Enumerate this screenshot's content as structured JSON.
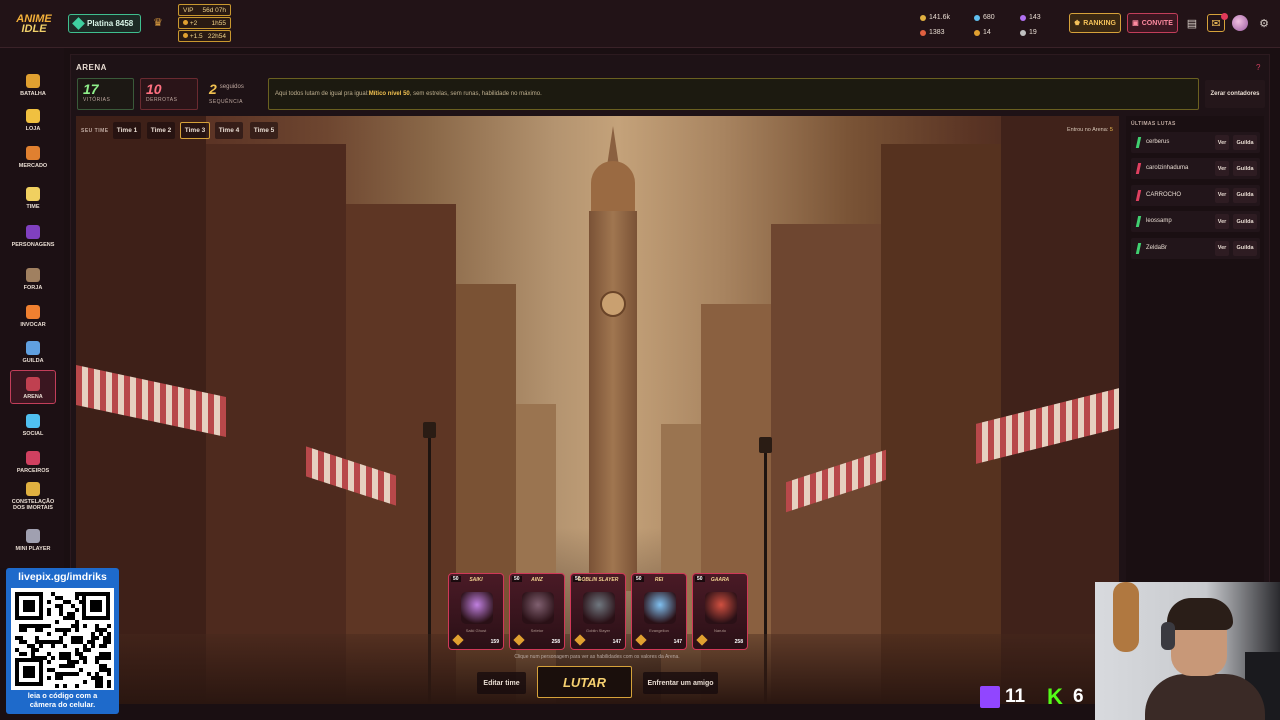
{
  "app": {
    "logo_line1": "ANIME",
    "logo_line2": "IDLE"
  },
  "topbar": {
    "rank": "Platina 8458",
    "vip": {
      "label": "VIP",
      "time": "56d 07h",
      "boost1_label": "+2",
      "boost1_time": "1h55",
      "boost2_label": "+1.5",
      "boost2_time": "22h54"
    },
    "currencies": [
      {
        "value": "141.6k",
        "color": "#e0b040"
      },
      {
        "value": "680",
        "color": "#60c0f0"
      },
      {
        "value": "143",
        "color": "#b070f0"
      },
      {
        "value": "1383",
        "color": "#e06040"
      },
      {
        "value": "14",
        "color": "#e0a030"
      },
      {
        "value": "19",
        "color": "#c0c0c0"
      }
    ],
    "ranking_label": "RANKING",
    "convite_label": "CONVITE"
  },
  "sidebar": [
    {
      "label": "BATALHA",
      "color": "#e0a030"
    },
    {
      "label": "LOJA",
      "color": "#f0c040"
    },
    {
      "label": "MERCADO",
      "color": "#e08030"
    },
    {
      "label": "TIME",
      "color": "#f0d060"
    },
    {
      "label": "PERSONAGENS",
      "color": "#8040c0"
    },
    {
      "label": "FORJA",
      "color": "#a08060"
    },
    {
      "label": "INVOCAR",
      "color": "#f08030"
    },
    {
      "label": "GUILDA",
      "color": "#60a0e0"
    },
    {
      "label": "ARENA",
      "color": "#c04050"
    },
    {
      "label": "SOCIAL",
      "color": "#50c0f0"
    },
    {
      "label": "PARCEIROS",
      "color": "#d04060"
    },
    {
      "label": "CONSTELAÇÃO DOS IMORTAIS",
      "color": "#e0b040"
    },
    {
      "label": "MINI PLAYER",
      "color": "#a0a0b0"
    }
  ],
  "arena": {
    "title": "ARENA",
    "wins": "17",
    "wins_label": "VITÓRIAS",
    "losses": "10",
    "losses_label": "DERROTAS",
    "streak": "2",
    "streak_sub": "seguidos",
    "streak_label": "SEQUÊNCIA",
    "info_prefix": "Aqui todos lutam de igual pra igual:",
    "info_highlight": "Mítico nível 50",
    "info_suffix": ", sem estrelas, sem runas, habilidade no máximo.",
    "reset_label": "Zerar contadores",
    "team_label": "SEU TIME",
    "tabs": [
      "Time 1",
      "Time 2",
      "Time 3",
      "Time 4",
      "Time 5"
    ],
    "active_tab": 2,
    "entries_label": "Entrou no Arena:",
    "entries_value": "5"
  },
  "cards": [
    {
      "level": "50",
      "name": "SAIKI",
      "sub": "Saiki Ghost",
      "power": "159",
      "color": "#c080e0"
    },
    {
      "level": "50",
      "name": "AINZ",
      "sub": "Seletor",
      "power": "258",
      "color": "#806070"
    },
    {
      "level": "50",
      "name": "GOBLIN SLAYER",
      "sub": "Goblin Slayer",
      "power": "147",
      "color": "#707880"
    },
    {
      "level": "50",
      "name": "REI",
      "sub": "Evangelion",
      "power": "147",
      "color": "#80c0f0"
    },
    {
      "level": "50",
      "name": "GAARA",
      "sub": "Naruto",
      "power": "258",
      "color": "#d05040"
    }
  ],
  "hint": "Clique num personagem para ver as habilidades com os valores da Arena.",
  "actions": {
    "edit": "Editar time",
    "fight": "LUTAR",
    "friend": "Enfrentar um amigo"
  },
  "recent": {
    "title": "ÚLTIMAS LUTAS",
    "view_label": "Ver",
    "guild_label": "Guilda",
    "fights": [
      {
        "name": "cerberus",
        "won": true
      },
      {
        "name": "carolzinhaduma",
        "won": false
      },
      {
        "name": "CARROCHO",
        "won": false
      },
      {
        "name": "leossamp",
        "won": true
      },
      {
        "name": "ZeldaBr",
        "won": true
      }
    ]
  },
  "overlay": {
    "livepix": "livepix.gg/imdriks",
    "qr_caption1": "leia o código com a",
    "qr_caption2": "câmera do celular.",
    "twitch_count": "11",
    "kick_count": "6"
  }
}
